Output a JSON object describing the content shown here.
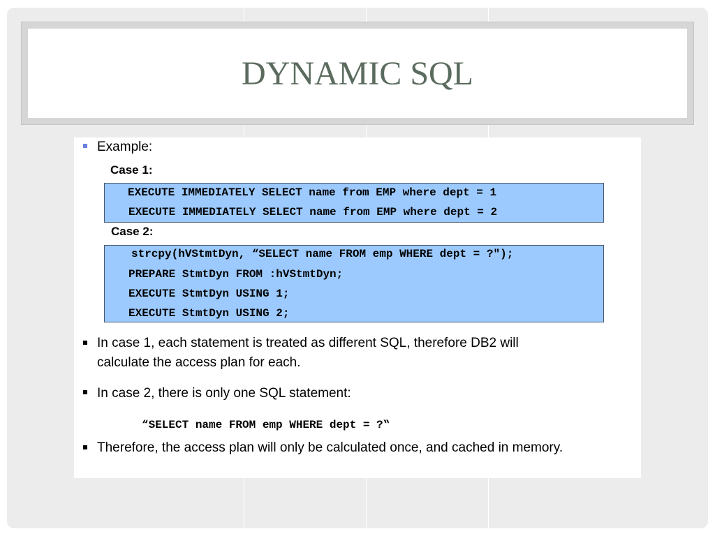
{
  "title": "DYNAMIC SQL",
  "example_label": "Example:",
  "case1": {
    "label": "Case 1:",
    "lines": [
      "EXECUTE IMMEDIATELY SELECT name from EMP where dept = 1",
      "EXECUTE IMMEDIATELY SELECT name from EMP where dept = 2"
    ]
  },
  "case2": {
    "label": "Case 2:",
    "lines": [
      "strcpy(hVStmtDyn, “SELECT name FROM emp WHERE dept = ?\");",
      "PREPARE StmtDyn FROM :hVStmtDyn;",
      "EXECUTE StmtDyn USING 1;",
      "EXECUTE StmtDyn USING 2;"
    ]
  },
  "bullets": {
    "b1_line1": "In case 1, each statement is treated as different SQL, therefore DB2 will",
    "b1_line2": "calculate the access plan for each.",
    "b2": "In case 2, there is only one SQL statement:",
    "b2_quote": "“SELECT name FROM emp WHERE dept = ?‟",
    "b3": "Therefore, the access plan will only be calculated once, and cached in memory."
  },
  "colors": {
    "title": "#5b6b5e",
    "code_background": "#9ccaff",
    "example_bullet": "#6d7fe0",
    "slide_background": "#ececec"
  }
}
